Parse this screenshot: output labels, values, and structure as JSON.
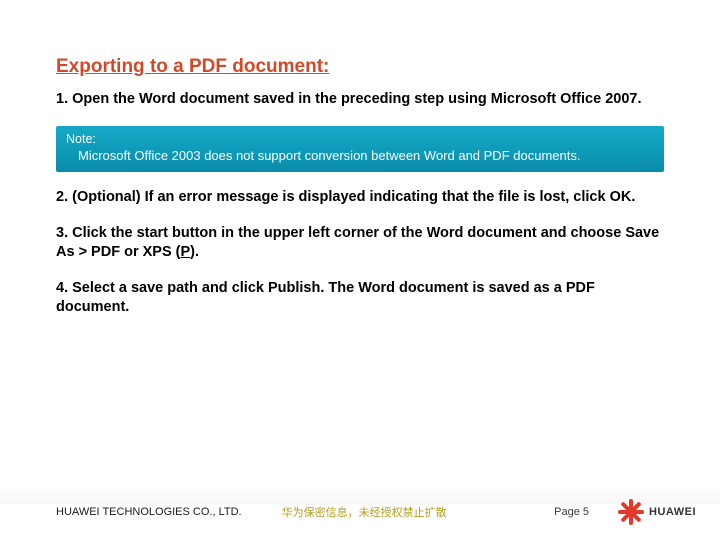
{
  "title": "Exporting to a PDF document:",
  "steps": {
    "s1": "1. Open the Word document saved in the preceding step using Microsoft Office 2007.",
    "s2_pre": "2. (Optional) If an error message is displayed indicating that the file is lost, click ",
    "s2_bold": "OK",
    "s2_post": ".",
    "s3_pre": "3. Click the start button in the upper left corner of the Word document and choose ",
    "s3_bold": "Save As > PDF or XPS (",
    "s3_u": "P",
    "s3_bold2": ")",
    "s3_post": ".",
    "s4_pre": "4. Select a save path and click ",
    "s4_bold": "Publish",
    "s4_post": ". The Word document is saved as a PDF document."
  },
  "note": {
    "label": "Note:",
    "body": "Microsoft Office 2003 does not support conversion between Word and PDF documents."
  },
  "footer": {
    "company": "HUAWEI TECHNOLOGIES CO., LTD.",
    "confidential": "华为保密信息，未经授权禁止扩散",
    "page": "Page 5",
    "brand": "HUAWEI"
  }
}
